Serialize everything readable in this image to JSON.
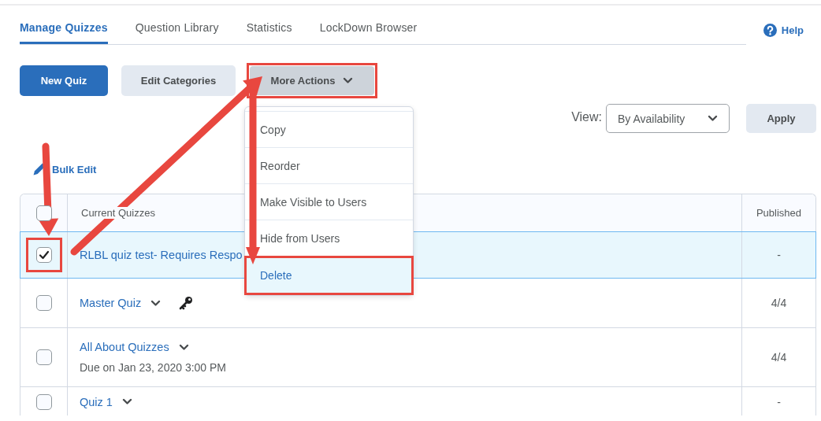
{
  "tabs": [
    {
      "label": "Manage Quizzes",
      "selected": true
    },
    {
      "label": "Question Library",
      "selected": false
    },
    {
      "label": "Statistics",
      "selected": false
    },
    {
      "label": "LockDown Browser",
      "selected": false
    }
  ],
  "help": {
    "label": "Help"
  },
  "actions": [
    {
      "label": "New Quiz",
      "kind": "primary",
      "highlighted": false
    },
    {
      "label": "Edit Categories",
      "kind": "secondary",
      "highlighted": false
    },
    {
      "label": "More Actions",
      "kind": "dropdown",
      "highlighted": true
    }
  ],
  "view": {
    "label": "View:",
    "value": "By Availability",
    "button": "Apply"
  },
  "bulk_edit": {
    "label": "Bulk Edit"
  },
  "table": {
    "columns": [
      "Current Quizzes",
      "Published"
    ],
    "header_checked": false,
    "rows": [
      {
        "title": "RLBL quiz test- Requires Respo",
        "checked": true,
        "selected": true,
        "highlighted": true,
        "has_menu": false,
        "has_key": false,
        "published": "-"
      },
      {
        "title": "Master Quiz",
        "checked": false,
        "selected": false,
        "highlighted": false,
        "has_menu": true,
        "has_key": true,
        "published": "4/4"
      },
      {
        "title": "All About Quizzes",
        "due": "Due on Jan 23, 2020 3:00 PM",
        "checked": false,
        "selected": false,
        "highlighted": false,
        "has_menu": true,
        "has_key": false,
        "published": "4/4"
      },
      {
        "title": "Quiz 1",
        "checked": false,
        "selected": false,
        "highlighted": false,
        "has_menu": true,
        "has_key": false,
        "published": "-"
      }
    ]
  },
  "menu": {
    "items": [
      {
        "label": "Copy",
        "selected": false,
        "highlighted": false
      },
      {
        "label": "Reorder",
        "selected": false,
        "highlighted": false
      },
      {
        "label": "Make Visible to Users",
        "selected": false,
        "highlighted": false
      },
      {
        "label": "Hide from Users",
        "selected": false,
        "highlighted": false
      },
      {
        "label": "Delete",
        "selected": true,
        "highlighted": true
      }
    ]
  }
}
